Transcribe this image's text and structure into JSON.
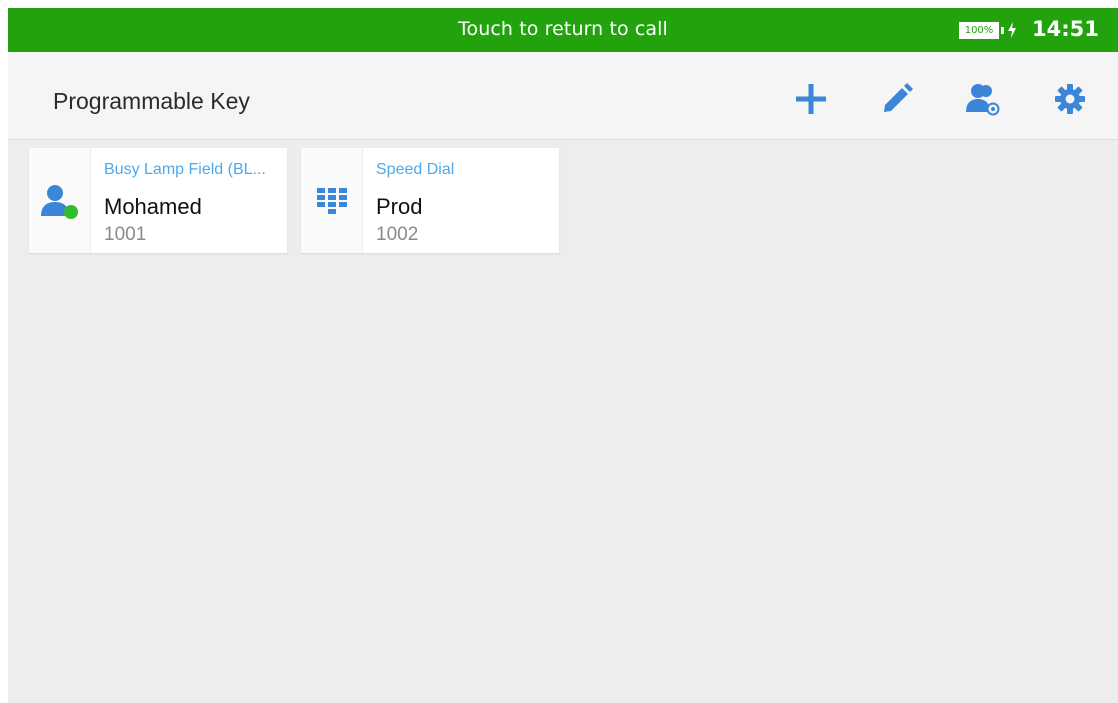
{
  "status_bar": {
    "message": "Touch to return to call",
    "battery_level": "100%",
    "time": "14:51",
    "background_color": "#22a30e"
  },
  "app_bar": {
    "title": "Programmable Key",
    "actions": [
      "add-icon",
      "edit-icon",
      "contact-view-icon",
      "settings-icon"
    ],
    "accent_color": "#3b86d8"
  },
  "keys": [
    {
      "type": "Busy Lamp Field (BL...",
      "name": "Mohamed",
      "number": "1001",
      "icon": "contact-icon",
      "status_color": "#2fbe2a"
    },
    {
      "type": "Speed Dial",
      "name": "Prod",
      "number": "1002",
      "icon": "dialpad-icon"
    }
  ]
}
